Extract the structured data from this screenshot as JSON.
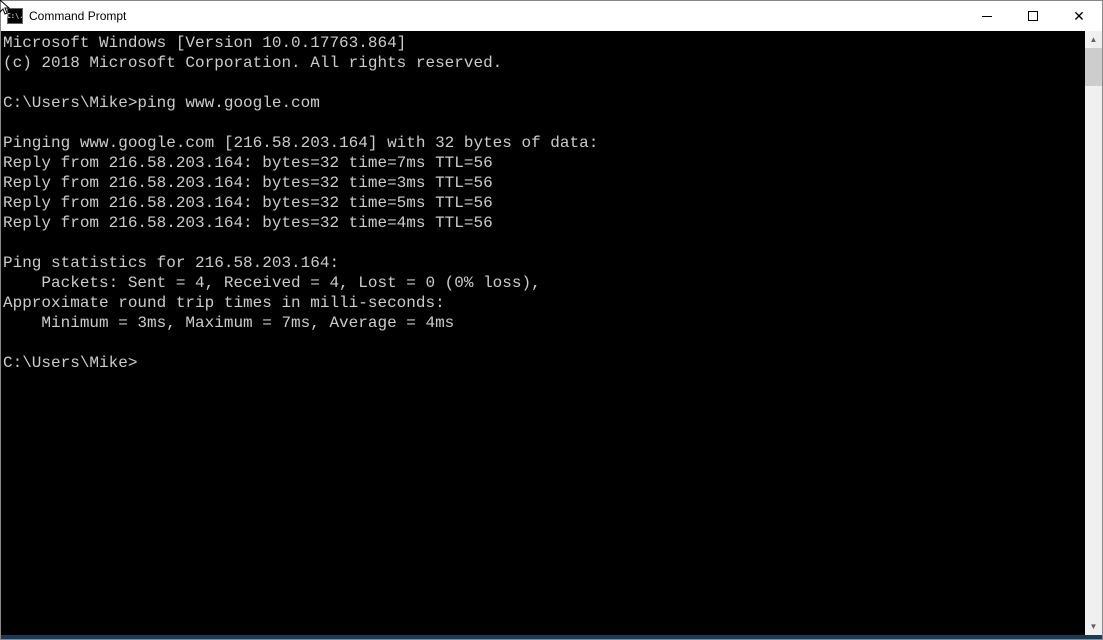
{
  "window": {
    "title": "Command Prompt",
    "icon_text": "C:\\."
  },
  "terminal": {
    "lines": [
      "Microsoft Windows [Version 10.0.17763.864]",
      "(c) 2018 Microsoft Corporation. All rights reserved.",
      "",
      "C:\\Users\\Mike>ping www.google.com",
      "",
      "Pinging www.google.com [216.58.203.164] with 32 bytes of data:",
      "Reply from 216.58.203.164: bytes=32 time=7ms TTL=56",
      "Reply from 216.58.203.164: bytes=32 time=3ms TTL=56",
      "Reply from 216.58.203.164: bytes=32 time=5ms TTL=56",
      "Reply from 216.58.203.164: bytes=32 time=4ms TTL=56",
      "",
      "Ping statistics for 216.58.203.164:",
      "    Packets: Sent = 4, Received = 4, Lost = 0 (0% loss),",
      "Approximate round trip times in milli-seconds:",
      "    Minimum = 3ms, Maximum = 7ms, Average = 4ms",
      "",
      "C:\\Users\\Mike>"
    ]
  }
}
